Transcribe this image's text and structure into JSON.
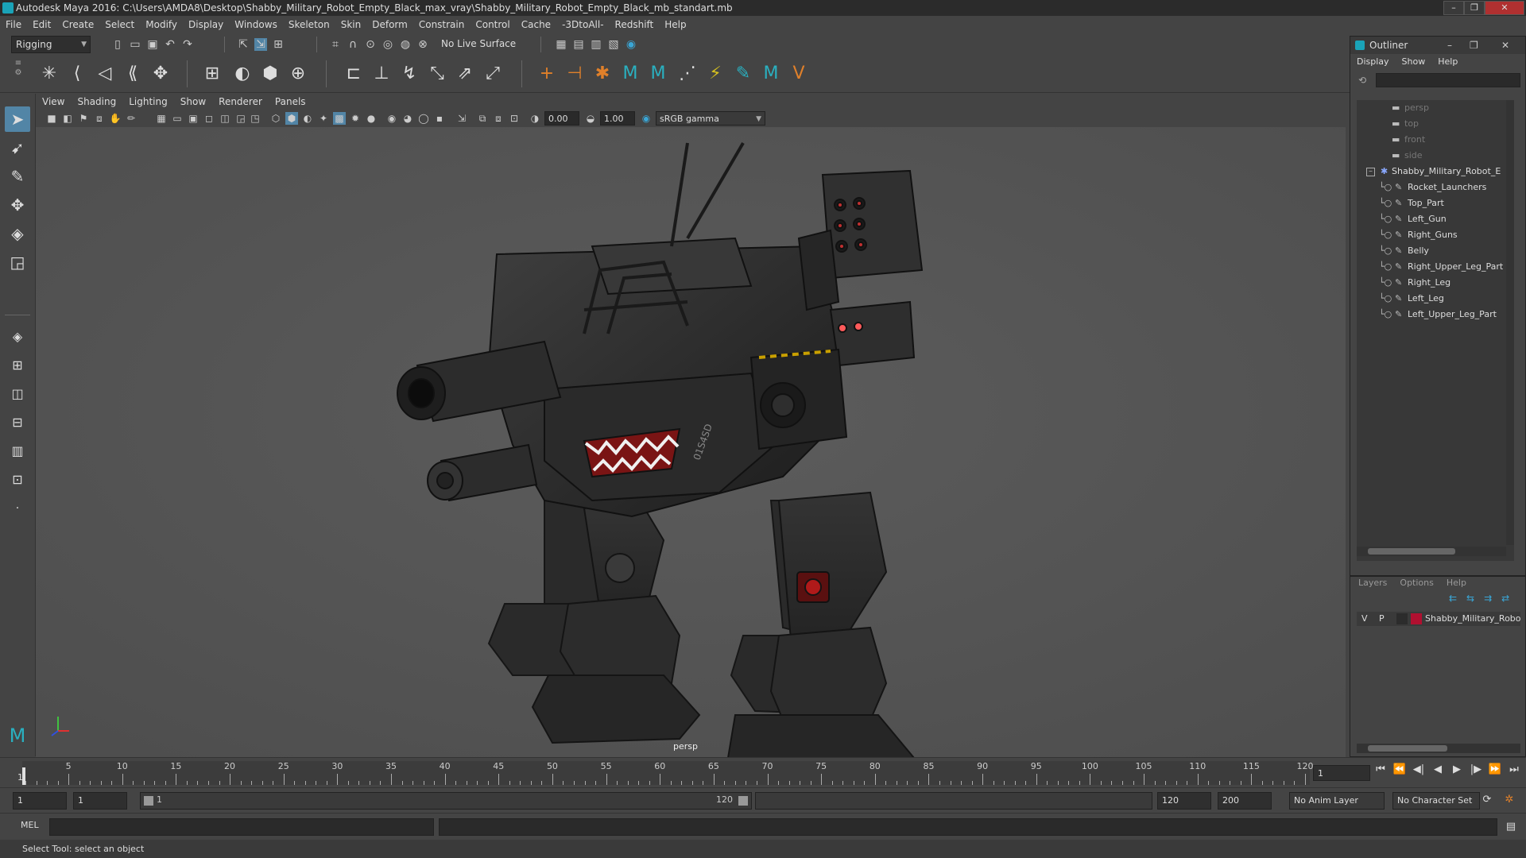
{
  "window": {
    "title": "Autodesk Maya 2016: C:\\Users\\AMDA8\\Desktop\\Shabby_Military_Robot_Empty_Black_max_vray\\Shabby_Military_Robot_Empty_Black_mb_standart.mb"
  },
  "menubar": {
    "items": [
      "File",
      "Edit",
      "Create",
      "Select",
      "Modify",
      "Display",
      "Windows",
      "Skeleton",
      "Skin",
      "Deform",
      "Constrain",
      "Control",
      "Cache",
      "-3DtoAll-",
      "Redshift",
      "Help"
    ]
  },
  "statusline": {
    "mode": "Rigging",
    "live_surface": "No Live Surface"
  },
  "viewport": {
    "menu": [
      "View",
      "Shading",
      "Lighting",
      "Show",
      "Renderer",
      "Panels"
    ],
    "field_a": "0.00",
    "field_b": "1.00",
    "color_space": "sRGB gamma",
    "camera_label": "persp",
    "robot_markings": "01S4SD"
  },
  "outliner": {
    "title": "Outliner",
    "menu": [
      "Display",
      "Show",
      "Help"
    ],
    "cameras": [
      "persp",
      "top",
      "front",
      "side"
    ],
    "root": "Shabby_Military_Robot_E",
    "children": [
      "Rocket_Launchers",
      "Top_Part",
      "Left_Gun",
      "Right_Guns",
      "Belly",
      "Right_Upper_Leg_Part",
      "Right_Leg",
      "Left_Leg",
      "Left_Upper_Leg_Part"
    ]
  },
  "layers": {
    "menu": [
      "Layers",
      "Options",
      "Help"
    ],
    "v": "V",
    "p": "P",
    "layer_name": "Shabby_Military_Robo",
    "layer_color": "#b01030"
  },
  "timeline": {
    "ticks": [
      "5",
      "10",
      "15",
      "20",
      "25",
      "30",
      "35",
      "40",
      "45",
      "50",
      "55",
      "60",
      "65",
      "70",
      "75",
      "80",
      "85",
      "90",
      "95",
      "100",
      "105",
      "110",
      "115",
      "120"
    ],
    "current_frame_marker": "1",
    "current_frame_field": "1"
  },
  "range": {
    "start_a": "1",
    "start_b": "1",
    "slider_start": "1",
    "slider_end": "120",
    "end": "120",
    "max": "200",
    "anim_layer": "No Anim Layer",
    "char_set": "No Character Set"
  },
  "cmdline": {
    "label": "MEL"
  },
  "helpline": {
    "text": "Select Tool: select an object"
  }
}
